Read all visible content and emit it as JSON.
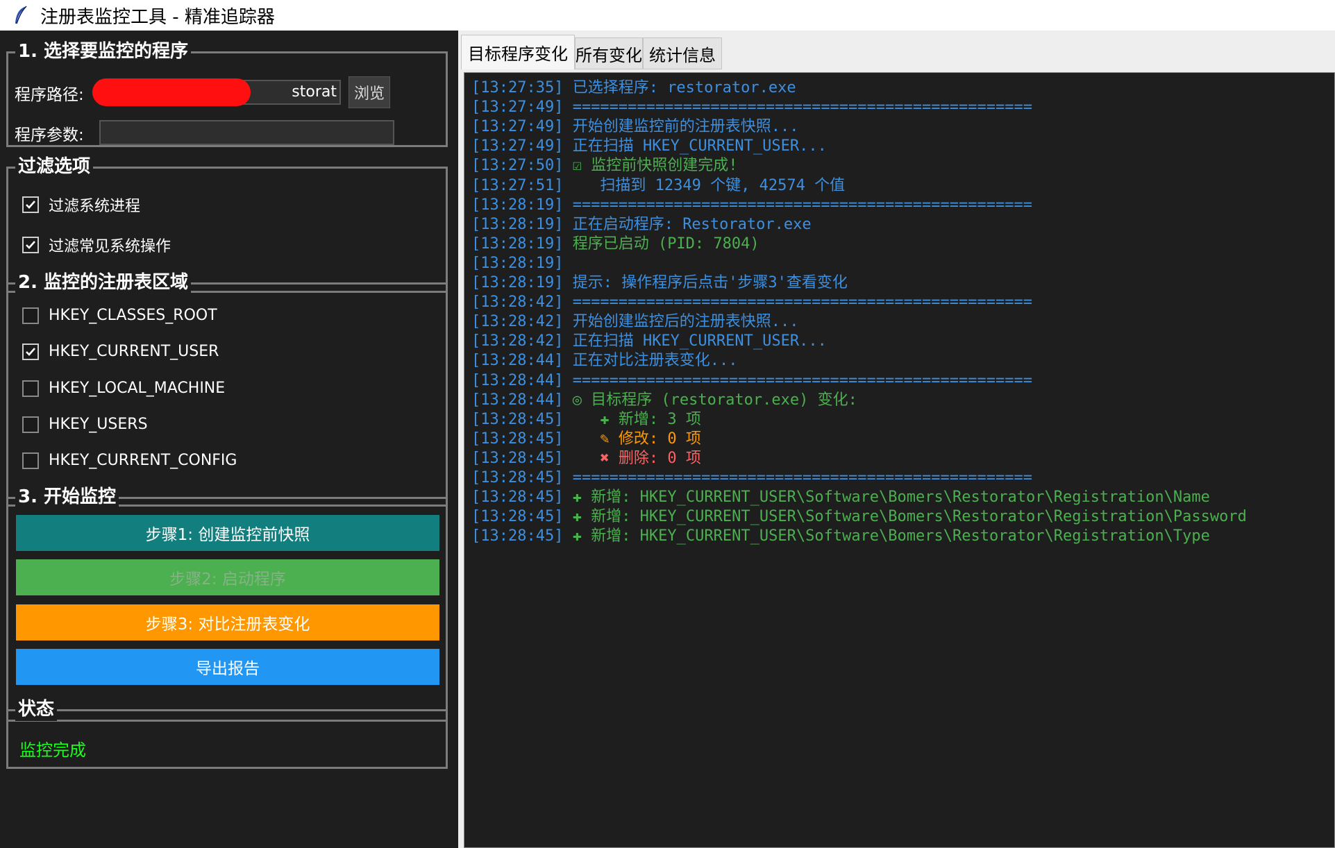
{
  "window": {
    "title": "注册表监控工具 - 精准追踪器"
  },
  "program_section": {
    "title": "1. 选择要监控的程序",
    "path_label": "程序路径:",
    "path_value_visible": "storat",
    "browse_label": "浏览",
    "args_label": "程序参数:",
    "args_value": ""
  },
  "filter_section": {
    "title": "过滤选项",
    "options": [
      {
        "label": "过滤系统进程",
        "checked": true
      },
      {
        "label": "过滤常见系统操作",
        "checked": true
      }
    ]
  },
  "region_section": {
    "title": "2. 监控的注册表区域",
    "hives": [
      {
        "label": "HKEY_CLASSES_ROOT",
        "checked": false
      },
      {
        "label": "HKEY_CURRENT_USER",
        "checked": true
      },
      {
        "label": "HKEY_LOCAL_MACHINE",
        "checked": false
      },
      {
        "label": "HKEY_USERS",
        "checked": false
      },
      {
        "label": "HKEY_CURRENT_CONFIG",
        "checked": false
      }
    ]
  },
  "monitor_section": {
    "title": "3. 开始监控",
    "buttons": [
      {
        "label": "步骤1: 创建监控前快照",
        "color": "#137e7e",
        "text_color": "#ffffff",
        "enabled": true
      },
      {
        "label": "步骤2: 启动程序",
        "color": "#4caf50",
        "text_color": "#86b386",
        "enabled": false
      },
      {
        "label": "步骤3: 对比注册表变化",
        "color": "#ff9800",
        "text_color": "#ffffff",
        "enabled": true
      },
      {
        "label": "导出报告",
        "color": "#2196f3",
        "text_color": "#ffffff",
        "enabled": true
      }
    ]
  },
  "status_section": {
    "title": "状态",
    "text": "监控完成",
    "color": "#1aff1a"
  },
  "tabs": [
    {
      "label": "目标程序变化",
      "active": true
    },
    {
      "label": "所有变化",
      "active": false
    },
    {
      "label": "统计信息",
      "active": false
    }
  ],
  "log": [
    {
      "ts": "[13:27:35]",
      "msg": " 已选择程序: restorator.exe",
      "color": "#3d8fe0"
    },
    {
      "ts": "[13:27:49]",
      "msg": " ==================================================",
      "color": "#3d8fe0"
    },
    {
      "ts": "[13:27:49]",
      "msg": " 开始创建监控前的注册表快照...",
      "color": "#3d8fe0"
    },
    {
      "ts": "[13:27:49]",
      "msg": " 正在扫描 HKEY_CURRENT_USER...",
      "color": "#3d8fe0"
    },
    {
      "ts": "[13:27:50]",
      "msg": " ☑ 监控前快照创建完成!",
      "color": "#4caf50"
    },
    {
      "ts": "[13:27:51]",
      "msg": "    扫描到 12349 个键, 42574 个值",
      "color": "#3d8fe0"
    },
    {
      "ts": "[13:28:19]",
      "msg": " ==================================================",
      "color": "#3d8fe0"
    },
    {
      "ts": "[13:28:19]",
      "msg": " 正在启动程序: Restorator.exe",
      "color": "#3d8fe0"
    },
    {
      "ts": "[13:28:19]",
      "msg": " 程序已启动 (PID: 7804)",
      "color": "#4caf50"
    },
    {
      "ts": "[13:28:19]",
      "msg": "",
      "color": "#3d8fe0"
    },
    {
      "ts": "[13:28:19]",
      "msg": " 提示: 操作程序后点击'步骤3'查看变化",
      "color": "#3d8fe0"
    },
    {
      "ts": "[13:28:42]",
      "msg": " ==================================================",
      "color": "#3d8fe0"
    },
    {
      "ts": "[13:28:42]",
      "msg": " 开始创建监控后的注册表快照...",
      "color": "#3d8fe0"
    },
    {
      "ts": "[13:28:42]",
      "msg": " 正在扫描 HKEY_CURRENT_USER...",
      "color": "#3d8fe0"
    },
    {
      "ts": "[13:28:44]",
      "msg": " 正在对比注册表变化...",
      "color": "#3d8fe0"
    },
    {
      "ts": "[13:28:44]",
      "msg": " ==================================================",
      "color": "#3d8fe0"
    },
    {
      "ts": "[13:28:44]",
      "msg": " ◎ 目标程序 (restorator.exe) 变化:",
      "color": "#4caf50"
    },
    {
      "ts": "[13:28:45]",
      "msg": "    ✚ 新增: 3 项",
      "color": "#4caf50"
    },
    {
      "ts": "[13:28:45]",
      "msg": "    ✎ 修改: 0 项",
      "color": "#ff9800"
    },
    {
      "ts": "[13:28:45]",
      "msg": "    ✖ 删除: 0 项",
      "color": "#ff6060"
    },
    {
      "ts": "[13:28:45]",
      "msg": " ==================================================",
      "color": "#3d8fe0"
    },
    {
      "ts": "[13:28:45]",
      "msg": " ✚ 新增: HKEY_CURRENT_USER\\Software\\Bomers\\Restorator\\Registration\\Name",
      "color": "#4caf50"
    },
    {
      "ts": "[13:28:45]",
      "msg": " ✚ 新增: HKEY_CURRENT_USER\\Software\\Bomers\\Restorator\\Registration\\Password",
      "color": "#4caf50"
    },
    {
      "ts": "[13:28:45]",
      "msg": " ✚ 新增: HKEY_CURRENT_USER\\Software\\Bomers\\Restorator\\Registration\\Type",
      "color": "#4caf50"
    }
  ]
}
